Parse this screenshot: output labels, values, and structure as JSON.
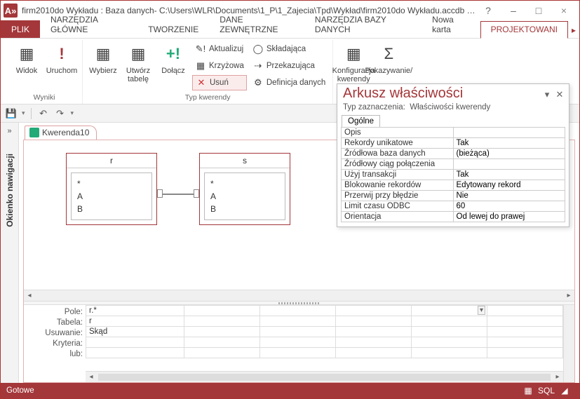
{
  "titlebar": {
    "app_icon_text": "A»",
    "title": "firm2010do Wykładu : Baza danych- C:\\Users\\WLR\\Documents\\1_P\\1_Zajecia\\Tpd\\Wykład\\firm2010do Wykładu.accdb (f...",
    "help": "?",
    "min": "–",
    "max": "□",
    "close": "×"
  },
  "tabs": {
    "file": "PLIK",
    "t1": "NARZĘDZIA GŁÓWNE",
    "t2": "TWORZENIE",
    "t3": "DANE ZEWNĘTRZNE",
    "t4": "NARZĘDZIA BAZY DANYCH",
    "t5": "Nowa karta",
    "t6": "PROJEKTOWANI"
  },
  "ribbon": {
    "g1": {
      "label": "Wyniki",
      "widok": "Widok",
      "uruchom": "Uruchom"
    },
    "g2": {
      "wybierz": "Wybierz",
      "utworz": "Utwórz tabelę",
      "dolacz": "Dołącz",
      "aktualizuj": "Aktualizuj",
      "krzyzowa": "Krzyżowa",
      "usun": "Usuń",
      "skladajaca": "Składająca",
      "przekazujaca": "Przekazująca",
      "definicja": "Definicja danych",
      "label": "Typ kwerendy"
    },
    "g3": {
      "konfig": "Konfiguracja kwerendy",
      "pokaz": "Pokazywanie/"
    }
  },
  "nav": {
    "label": "Okienko nawigacji"
  },
  "doc_tab": "Kwerenda10",
  "tables": {
    "r": {
      "name": "r",
      "f0": "*",
      "f1": "A",
      "f2": "B"
    },
    "s": {
      "name": "s",
      "f0": "*",
      "f1": "A",
      "f2": "B"
    }
  },
  "gridlabels": {
    "pole": "Pole:",
    "tabela": "Tabela:",
    "usuwanie": "Usuwanie:",
    "kryteria": "Kryteria:",
    "lub": "lub:"
  },
  "gridvals": {
    "pole": "r.*",
    "tabela": "r",
    "usuwanie": "Skąd"
  },
  "prop": {
    "title": "Arkusz właściwości",
    "sub_label": "Typ zaznaczenia:",
    "sub_value": "Właściwości kwerendy",
    "tab": "Ogólne",
    "rows": [
      {
        "k": "Opis",
        "v": ""
      },
      {
        "k": "Rekordy unikatowe",
        "v": "Tak"
      },
      {
        "k": "Źródłowa baza danych",
        "v": "(bieżąca)"
      },
      {
        "k": "Źródłowy ciąg połączenia",
        "v": ""
      },
      {
        "k": "Użyj transakcji",
        "v": "Tak"
      },
      {
        "k": "Blokowanie rekordów",
        "v": "Edytowany rekord"
      },
      {
        "k": "Przerwij przy błędzie",
        "v": "Nie"
      },
      {
        "k": "Limit czasu ODBC",
        "v": "60"
      },
      {
        "k": "Orientacja",
        "v": "Od lewej do prawej"
      }
    ]
  },
  "status": {
    "text": "Gotowe",
    "sql": "SQL"
  }
}
